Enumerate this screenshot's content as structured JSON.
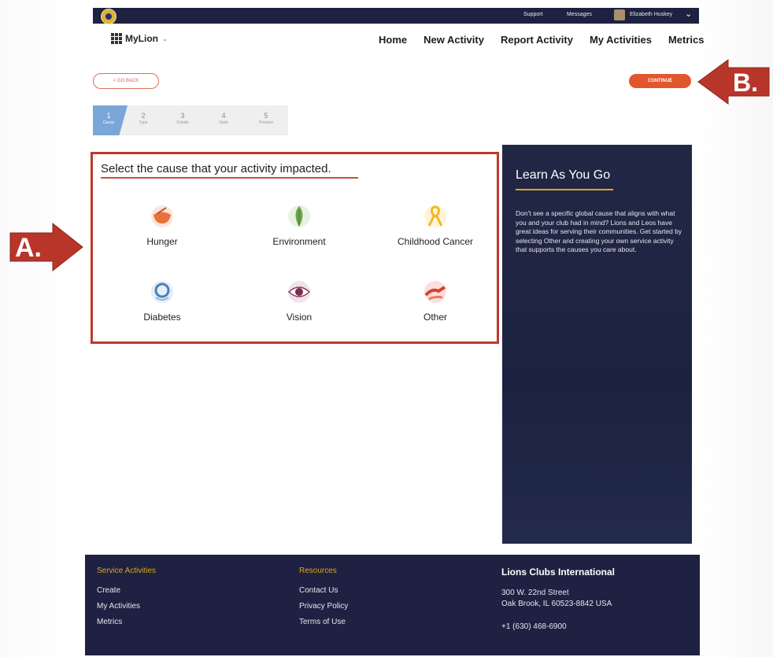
{
  "topbar": {
    "support": "Support",
    "messages": "Messages",
    "user_name": "Elizabeth Huskey"
  },
  "brand": {
    "name": "MyLion"
  },
  "nav": {
    "items": [
      "Home",
      "New Activity",
      "Report Activity",
      "My Activities",
      "Metrics"
    ]
  },
  "actions": {
    "go_back": "< GO BACK",
    "continue": "CONTINUE"
  },
  "stepper": {
    "steps": [
      {
        "num": "1",
        "label": "Cause"
      },
      {
        "num": "2",
        "label": "Type"
      },
      {
        "num": "3",
        "label": "Details"
      },
      {
        "num": "4",
        "label": "Stats"
      },
      {
        "num": "5",
        "label": "Preview"
      }
    ]
  },
  "cause": {
    "title": "Select the cause that your activity impacted.",
    "items": [
      "Hunger",
      "Environment",
      "Childhood Cancer",
      "Diabetes",
      "Vision",
      "Other"
    ]
  },
  "learn": {
    "title": "Learn As You Go",
    "body": "Don't see a specific global cause that aligns with what you and your club had in mind? Lions and Leos have great ideas for serving their communities. Get started by selecting Other and creating your own service activity that supports the causes you care about."
  },
  "footer": {
    "service_title": "Service Activities",
    "service_links": [
      "Create",
      "My Activities",
      "Metrics"
    ],
    "resources_title": "Resources",
    "resources_links": [
      "Contact Us",
      "Privacy Policy",
      "Terms of Use"
    ],
    "org_name": "Lions Clubs International",
    "address_line1": "300 W. 22nd Street",
    "address_line2": "Oak Brook, IL 60523-8842 USA",
    "phone": "+1 (630) 468-6900"
  },
  "annotations": {
    "a": "A.",
    "b": "B."
  },
  "colors": {
    "accent": "#e2562e",
    "callout": "#c0392b",
    "navy": "#1e2141",
    "gold": "#d9a81d",
    "step_active": "#7aa6d8"
  }
}
